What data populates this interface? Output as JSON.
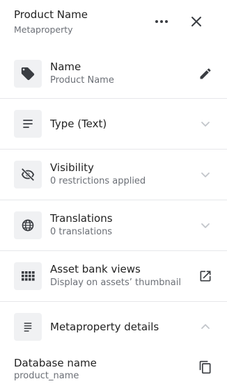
{
  "header": {
    "title": "Product Name",
    "subtitle": "Metaproperty"
  },
  "rows": [
    {
      "label": "Name",
      "sub": "Product Name",
      "icon": "tag-icon",
      "action": "edit-pencil-icon"
    },
    {
      "label": "Type (Text)",
      "sub": "",
      "icon": "text-lines-icon",
      "action": "chevron-down-icon"
    },
    {
      "label": "Visibility",
      "sub": "0 restrictions applied",
      "icon": "eye-off-icon",
      "action": "chevron-down-icon"
    },
    {
      "label": "Translations",
      "sub": "0 translations",
      "icon": "globe-icon",
      "action": "chevron-down-icon"
    },
    {
      "label": "Asset bank views",
      "sub": "Display on assets’ thumbnail",
      "icon": "grid-icon",
      "action": "open-in-new-icon"
    }
  ],
  "details": {
    "label": "Metaproperty details",
    "icon": "details-lines-icon",
    "action": "chevron-up-icon",
    "database_name_label": "Database name",
    "database_name_value": "product_name",
    "copy_icon": "copy-icon"
  },
  "colors": {
    "icon_box": "#f0f1f3",
    "divider": "#e6e7ea",
    "muted_text": "#6b6f76",
    "chevron": "#c2c5ca",
    "icon": "#3a3d42"
  }
}
